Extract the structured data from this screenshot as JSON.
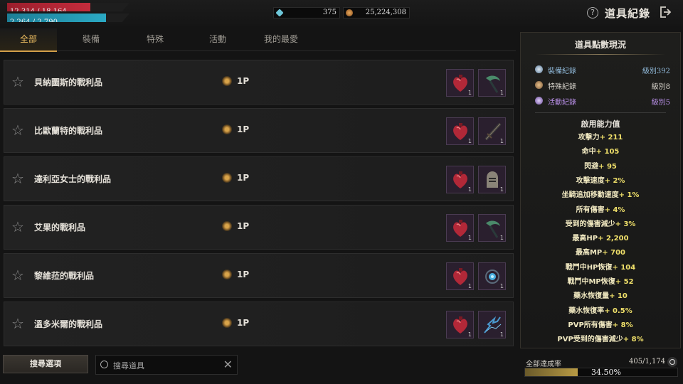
{
  "status": {
    "hp": {
      "text": "12,314 / 18,164",
      "fraction": 0.678
    },
    "mp": {
      "text": "2,264 / 2,790",
      "fraction": 0.811
    }
  },
  "currency": {
    "gem": {
      "icon": "diamond-icon",
      "value": "375"
    },
    "gold": {
      "icon": "gold-coin-icon",
      "value": "25,224,308"
    }
  },
  "header": {
    "title": "道具紀錄",
    "help_icon": "help-icon",
    "help_glyph": "?",
    "exit_icon": "exit-icon"
  },
  "tabs": [
    {
      "label": "全部",
      "active": true
    },
    {
      "label": "裝備",
      "active": false
    },
    {
      "label": "特殊",
      "active": false
    },
    {
      "label": "活動",
      "active": false
    },
    {
      "label": "我的最愛",
      "active": false
    }
  ],
  "rows": [
    {
      "name": "貝納圖斯的戰利品",
      "points": "1P",
      "items": [
        {
          "icon": "red-heart-relic-icon",
          "qty": "1"
        },
        {
          "icon": "green-scythe-icon",
          "qty": "1"
        }
      ]
    },
    {
      "name": "比歐蘭特的戰利品",
      "points": "1P",
      "items": [
        {
          "icon": "red-heart-relic-icon",
          "qty": "1"
        },
        {
          "icon": "dark-sword-icon",
          "qty": "1"
        }
      ]
    },
    {
      "name": "達利亞女士的戰利品",
      "points": "1P",
      "items": [
        {
          "icon": "red-heart-relic-icon",
          "qty": "1"
        },
        {
          "icon": "knight-helmet-icon",
          "qty": "1"
        }
      ]
    },
    {
      "name": "艾果的戰利品",
      "points": "1P",
      "items": [
        {
          "icon": "red-heart-relic-icon",
          "qty": "1"
        },
        {
          "icon": "green-scythe-icon",
          "qty": "1"
        }
      ]
    },
    {
      "name": "黎維菈的戰利品",
      "points": "1P",
      "items": [
        {
          "icon": "red-heart-relic-icon",
          "qty": "1"
        },
        {
          "icon": "blue-gem-amulet-icon",
          "qty": "1"
        }
      ]
    },
    {
      "name": "溫多米爾的戰利品",
      "points": "1P",
      "items": [
        {
          "icon": "red-heart-relic-icon",
          "qty": "1"
        },
        {
          "icon": "blue-lightning-whip-icon",
          "qty": "1"
        }
      ]
    }
  ],
  "search": {
    "button_label": "搜尋選項",
    "placeholder": "搜尋道具",
    "clear_glyph": "✕"
  },
  "panel": {
    "title": "道具點數現況",
    "categories": [
      {
        "name": "裝備紀錄",
        "value": "級別392",
        "color": "#8fb8d8",
        "icon": "equipment-record-icon"
      },
      {
        "name": "特殊紀錄",
        "value": "級別8",
        "color": "#d8d4cc",
        "icon": "special-record-icon"
      },
      {
        "name": "活動紀錄",
        "value": "級別5",
        "color": "#b98fe8",
        "icon": "event-record-icon"
      }
    ],
    "abilities_title": "啟用能力值",
    "abilities": [
      {
        "label": "攻擊力",
        "value": "+ 211"
      },
      {
        "label": "命中",
        "value": "+ 105"
      },
      {
        "label": "閃避",
        "value": "+ 95"
      },
      {
        "label": "攻擊速度",
        "value": "+ 2%"
      },
      {
        "label": "坐騎追加移動速度",
        "value": "+ 1%"
      },
      {
        "label": "所有傷害",
        "value": "+ 4%"
      },
      {
        "label": "受到的傷害減少",
        "value": "+ 3%"
      },
      {
        "label": "最高HP",
        "value": "+ 2,200"
      },
      {
        "label": "最高MP",
        "value": "+ 700"
      },
      {
        "label": "戰鬥中HP恢復",
        "value": "+ 104"
      },
      {
        "label": "戰鬥中MP恢復",
        "value": "+ 52"
      },
      {
        "label": "藥水恢復量",
        "value": "+ 10"
      },
      {
        "label": "藥水恢復率",
        "value": "+ 0.5%"
      },
      {
        "label": "PVP所有傷害",
        "value": "+ 8%"
      },
      {
        "label": "PVP受到的傷害減少",
        "value": "+ 8%"
      }
    ]
  },
  "achievement": {
    "label": "全部達成率",
    "count": "405/1,174",
    "percent": "34.50%",
    "fraction": 0.345
  }
}
